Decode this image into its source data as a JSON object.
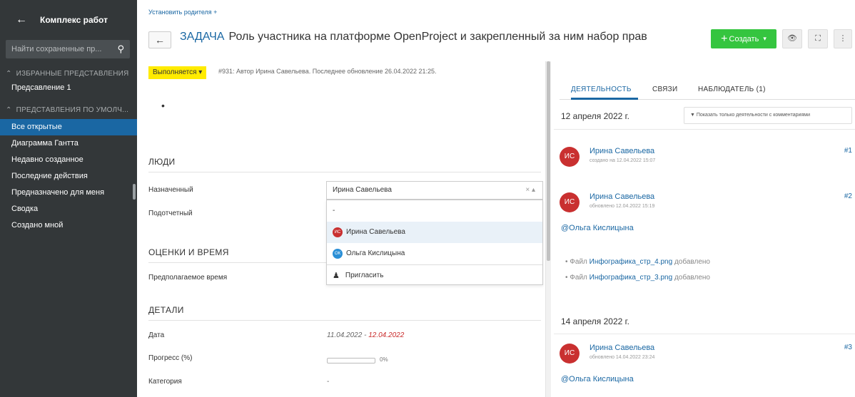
{
  "sidebar": {
    "back_label": "Комплекс работ",
    "search_placeholder": "Найти сохраненные пр...",
    "section_favorites": "ИЗБРАННЫЕ ПРЕДСТАВЛЕНИЯ",
    "favorites": [
      "Предсавление 1"
    ],
    "section_default": "ПРЕДСТАВЛЕНИЯ ПО УМОЛЧ...",
    "items": [
      "Все открытые",
      "Диаграмма Гантта",
      "Недавно созданное",
      "Последние действия",
      "Предназначено для меня",
      "Сводка",
      "Создано мной"
    ],
    "active_index": 0
  },
  "header": {
    "breadcrumb": "Установить родителя +",
    "back_arrow": "←",
    "type": "ЗАДАЧА",
    "subject": "Роль участника на платформе OpenProject и закрепленный за ним набор прав",
    "create_label": "Создать",
    "plus": "+",
    "dropdown_caret": "▾",
    "watch_icon": "👁",
    "fullscreen_icon": "⛶",
    "more_icon": "⋮"
  },
  "work_package": {
    "status": "Выполняется",
    "meta": "#931: Автор Ирина Савельева. Последнее обновление 26.04.2022 21:25.",
    "description_bullet": "•",
    "people_section": "ЛЮДИ",
    "assignee_label": "Назначенный",
    "assignee_value": "Ирина Савельева",
    "responsible_label": "Подотчетный",
    "estimates_section": "ОЦЕНКИ И ВРЕМЯ",
    "estimated_label": "Предполагаемое время",
    "details_section": "ДЕТАЛИ",
    "date_label": "Дата",
    "date_start": "11.04.2022",
    "date_sep": " - ",
    "date_end": "12.04.2022",
    "progress_label": "Прогресс (%)",
    "progress_value": "0%",
    "progress_fraction": 0,
    "category_label": "Категория",
    "category_value": "-"
  },
  "dropdown": {
    "clear": "× ▴",
    "options": [
      {
        "label": "-",
        "initials": "",
        "color": ""
      },
      {
        "label": "Ирина Савельева",
        "initials": "ИС",
        "color": "#c93030"
      },
      {
        "label": "Ольга Кислицына",
        "initials": "ОК",
        "color": "#2a8fd6"
      }
    ],
    "invite_label": "Пригласить",
    "invite_icon": "♟"
  },
  "activity": {
    "tabs": [
      "ДЕЯТЕЛЬНОСТЬ",
      "СВЯЗИ",
      "НАБЛЮДАТЕЛЬ (1)"
    ],
    "filter_label": "Показать только деятельности с комментариями",
    "filter_icon": "▼",
    "day1": "12 апреля 2022 г.",
    "day2": "14 апреля 2022 г.",
    "entries": [
      {
        "initials": "ИС",
        "user": "Ирина Савельева",
        "date": "создано на 12.04.2022 15:07",
        "num": "#1"
      },
      {
        "initials": "ИС",
        "user": "Ирина Савельева",
        "date": "обновлено 12.04.2022 15:19",
        "num": "#2"
      },
      {
        "initials": "ИС",
        "user": "Ирина Савельева",
        "date": "обновлено 14.04.2022 23:24",
        "num": "#3"
      }
    ],
    "mention": "@Ольга Кислицына",
    "att_prefix": "• Файл ",
    "att_suffix": " добавлено",
    "attachments": [
      "Инфографика_стр_4.png",
      "Инфографика_стр_3.png"
    ]
  }
}
